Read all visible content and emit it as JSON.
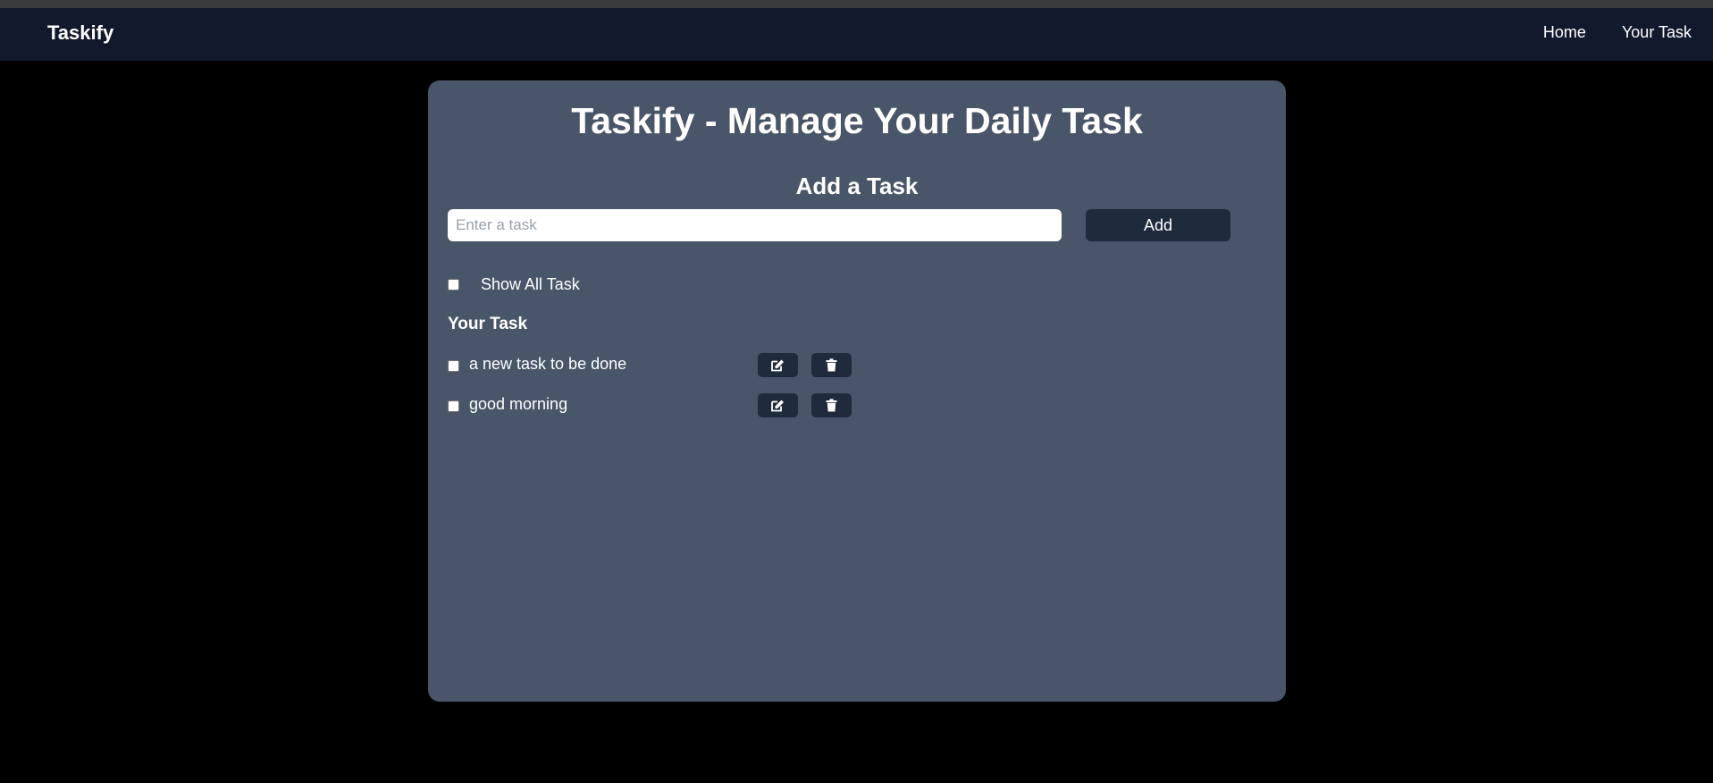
{
  "navbar": {
    "brand": "Taskify",
    "links": [
      {
        "label": "Home"
      },
      {
        "label": "Your Task"
      }
    ]
  },
  "card": {
    "title": "Taskify - Manage Your Daily Task",
    "add_section_title": "Add a Task",
    "input_placeholder": "Enter a task",
    "input_value": "",
    "add_button_label": "Add",
    "show_all_label": "Show All Task",
    "show_all_checked": false,
    "list_heading": "Your Task",
    "tasks": [
      {
        "text": "a new task to be done",
        "done": false
      },
      {
        "text": "good morning",
        "done": false
      }
    ],
    "icons": {
      "edit": "edit-icon",
      "delete": "trash-icon"
    }
  },
  "colors": {
    "page_bg": "#000000",
    "navbar_bg": "#111a2d",
    "card_bg": "#495669",
    "button_bg": "#1f2a3d",
    "text": "#ffffff"
  }
}
